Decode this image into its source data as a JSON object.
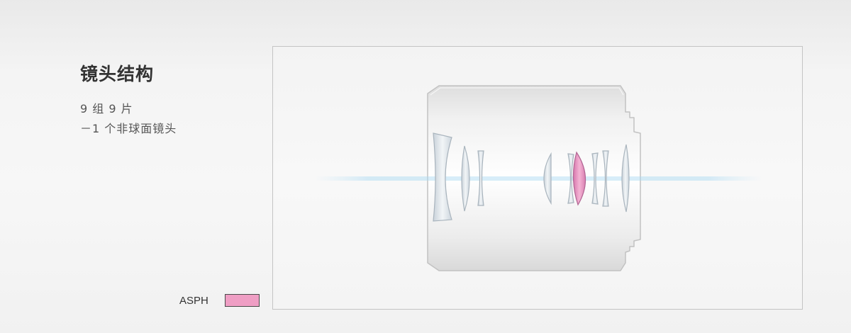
{
  "panel": {
    "title": "镜头结构",
    "spec_lines": [
      "9 组 9 片",
      "－1 个非球面镜头"
    ]
  },
  "legend": {
    "label": "ASPH",
    "color": "#ef9ec4"
  },
  "diagram": {
    "lens_body_color": "#f0f0f0",
    "element_color": "#dfe5ea",
    "aspherical_color": "#e899c2",
    "optical_axis_color": "#9ed0ec"
  }
}
